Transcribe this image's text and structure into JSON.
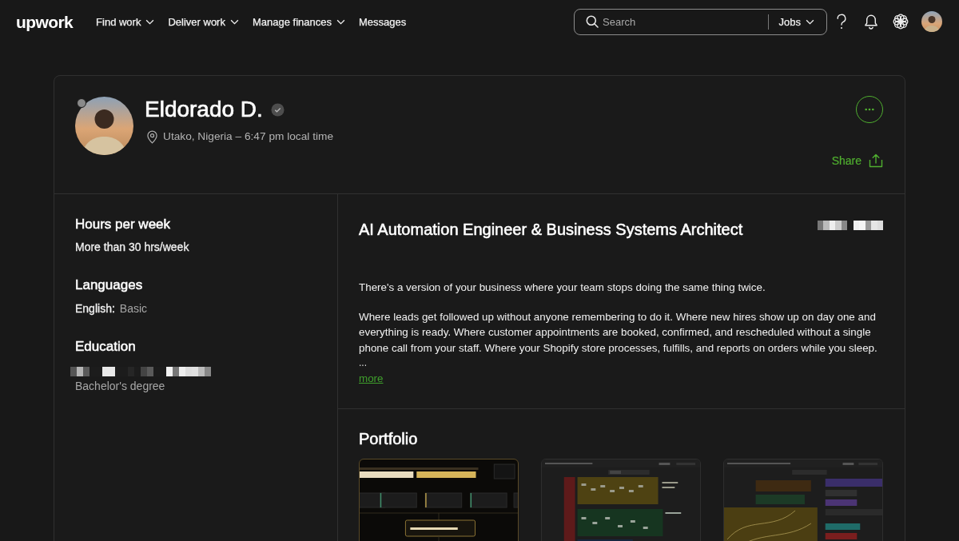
{
  "nav": {
    "logo": "upwork",
    "items": [
      {
        "label": "Find work",
        "dropdown": true
      },
      {
        "label": "Deliver work",
        "dropdown": true
      },
      {
        "label": "Manage finances",
        "dropdown": true
      },
      {
        "label": "Messages",
        "dropdown": false
      }
    ],
    "search": {
      "placeholder": "Search",
      "scope": "Jobs"
    }
  },
  "profile": {
    "name": "Eldorado D.",
    "online": false,
    "verified": true,
    "location": "Utako, Nigeria – 6:47 pm local time",
    "share": "Share"
  },
  "sidebar": {
    "sections": [
      {
        "kind": "text",
        "heading": "Hours per week",
        "value": "More than 30 hrs/week"
      },
      {
        "kind": "language",
        "heading": "Languages",
        "language": "English:",
        "proficiency": "Basic"
      },
      {
        "kind": "education",
        "heading": "Education",
        "school_redacted": true,
        "degree": "Bachelor's degree"
      }
    ]
  },
  "overview": {
    "title": "AI Automation Engineer & Business Systems Architect",
    "rate_redacted": true,
    "paragraphs": [
      "There's a version of your business where your team stops doing the same thing twice.",
      "Where leads get followed up without anyone remembering to do it. Where new hires show up on day one and everything is ready. Where customer appointments are booked, confirmed, and rescheduled without a single phone call from your staff. Where your Shopify store processes, fulfills, and reports on orders while you sleep."
    ],
    "ellipsis": "...",
    "more": "more"
  },
  "portfolio": {
    "heading": "Portfolio",
    "items": [
      {
        "kind": "slide"
      },
      {
        "kind": "workflow"
      },
      {
        "kind": "canvas"
      }
    ]
  }
}
